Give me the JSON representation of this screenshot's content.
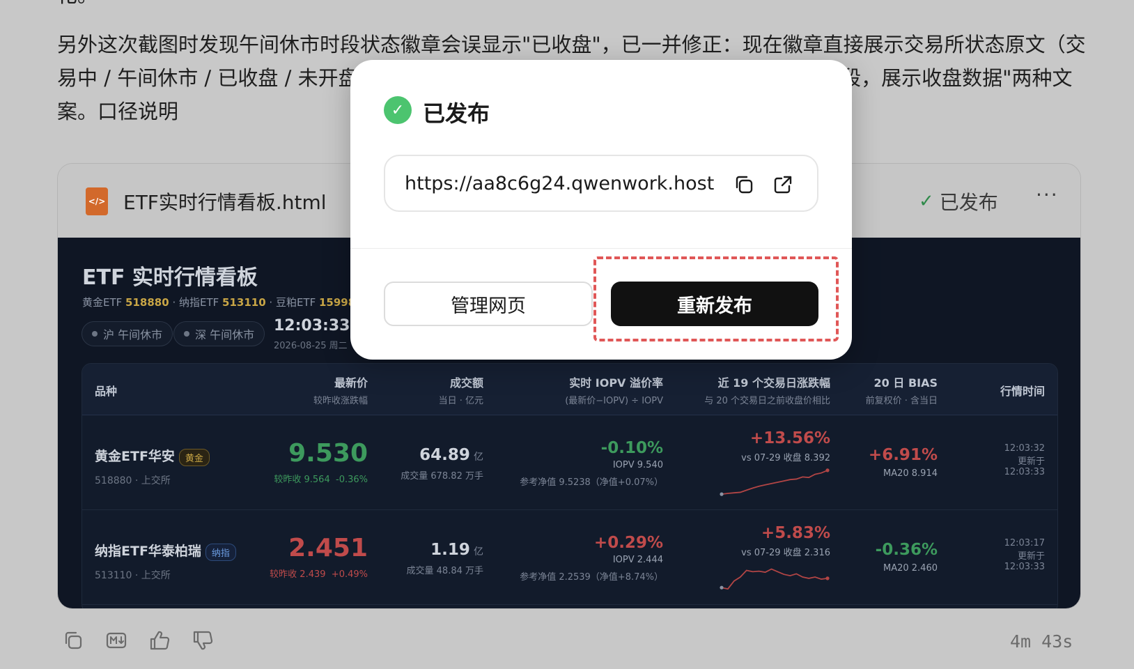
{
  "message": {
    "clipped_top": "化。",
    "paragraph": "另外这次截图时发现午间休市时段状态徽章会误显示\"已收盘\"，已一并修正：现在徽章直接展示交易所状态原文（交易中 / 午间休市 / 已收盘 / 未开盘），并区分\"交易时段，展示实时行情数据\"和\"非交易时段，展示收盘数据\"两种文案。口径说明"
  },
  "artifact": {
    "file_icon": "</>",
    "file_name": "ETF实时行情看板.html",
    "status_label": "已发布",
    "more_label": "···"
  },
  "dashboard": {
    "title": "ETF 实时行情看板",
    "sub_parts": [
      "黄金ETF ",
      "518880",
      " · 纳指ETF ",
      "513110",
      " · 豆粕ETF ",
      "159985"
    ],
    "pills": [
      "沪 午间休市",
      "深 午间休市"
    ],
    "time": "12:03:33",
    "date": "2026-08-25 周二",
    "headers": [
      {
        "t1": "品种",
        "t2": ""
      },
      {
        "t1": "最新价",
        "t2": "较昨收涨跌幅"
      },
      {
        "t1": "成交额",
        "t2": "当日 · 亿元"
      },
      {
        "t1": "实时 IOPV 溢价率",
        "t2": "(最新价−IOPV) ÷ IOPV"
      },
      {
        "t1": "近 19 个交易日涨跌幅",
        "t2": "与 20 个交易日之前收盘价相比"
      },
      {
        "t1": "20 日 BIAS",
        "t2": "前复权价 · 含当日"
      },
      {
        "t1": "行情时间",
        "t2": ""
      }
    ],
    "rows": [
      {
        "name": "黄金ETF华安",
        "tag": "黄金",
        "code": "518880 · 上交所",
        "price": "9.530",
        "prev": "较昨收 9.564",
        "pct": "-0.36%",
        "turnover": "64.89",
        "unit": "亿",
        "volume": "成交量 678.82 万手",
        "premium": "-0.10%",
        "iopv": "IOPV 9.540",
        "nav": "参考净值 9.5238（净值+0.07%）",
        "chg19": "+13.56%",
        "vs": "vs 07-29 收盘 8.392",
        "bias": "+6.91%",
        "ma": "MA20 8.914",
        "t_a": "12:03:32",
        "t_b": "更新于",
        "t_c": "12:03:33",
        "spark": [
          0.05,
          0.08,
          0.1,
          0.12,
          0.2,
          0.28,
          0.35,
          0.4,
          0.45,
          0.5,
          0.55,
          0.6,
          0.62,
          0.7,
          0.68,
          0.8,
          0.85,
          0.95
        ]
      },
      {
        "name": "纳指ETF华泰柏瑞",
        "tag": "纳指",
        "code": "513110 · 上交所",
        "price": "2.451",
        "prev": "较昨收 2.439",
        "pct": "+0.49%",
        "turnover": "1.19",
        "unit": "亿",
        "volume": "成交量 48.84 万手",
        "premium": "+0.29%",
        "iopv": "IOPV 2.444",
        "nav": "参考净值 2.2539（净值+8.74%）",
        "chg19": "+5.83%",
        "vs": "vs 07-29 收盘 2.316",
        "bias": "-0.36%",
        "ma": "MA20 2.460",
        "t_a": "12:03:17",
        "t_b": "更新于",
        "t_c": "12:03:33",
        "spark": [
          0.1,
          0.05,
          0.35,
          0.5,
          0.75,
          0.7,
          0.72,
          0.68,
          0.8,
          0.7,
          0.6,
          0.55,
          0.62,
          0.5,
          0.45,
          0.5,
          0.42,
          0.45
        ]
      }
    ]
  },
  "popup": {
    "title": "已发布",
    "url": "https://aa8c6g24.qwenwork.host",
    "manage_label": "管理网页",
    "republish_label": "重新发布"
  },
  "footer": {
    "icons": [
      "copy-icon",
      "markdown-icon",
      "thumbs-up-icon",
      "thumbs-down-icon"
    ],
    "elapsed": "4m 43s"
  },
  "colors": {
    "accent_green": "#4cc46f",
    "highlight_red": "#e05757",
    "up_red": "#c04b4b",
    "down_green": "#3d9a5d"
  }
}
